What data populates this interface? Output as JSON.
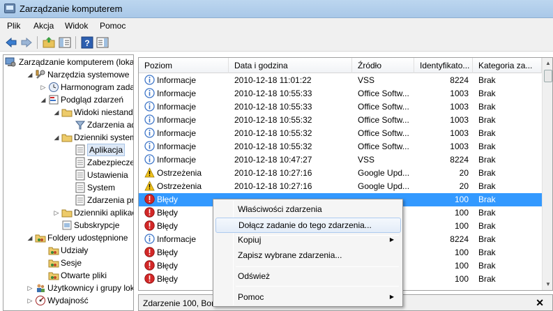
{
  "window": {
    "title": "Zarządzanie komputerem"
  },
  "menu": [
    "Plik",
    "Akcja",
    "Widok",
    "Pomoc"
  ],
  "toolbar": {
    "icons": [
      "back-arrow-icon",
      "forward-arrow-icon",
      "up-folder-icon",
      "show-hide-tree-icon",
      "help-icon",
      "action-pane-icon"
    ]
  },
  "tree": [
    {
      "label": "Zarządzanie komputerem (loka",
      "icon": "computer-management-icon",
      "expander": ""
    },
    {
      "label": "Narzędzia systemowe",
      "icon": "tools-icon",
      "expander": "◢"
    },
    {
      "label": "Harmonogram zadań",
      "icon": "clock-icon",
      "expander": "▷"
    },
    {
      "label": "Podgląd zdarzeń",
      "icon": "event-viewer-icon",
      "expander": "◢"
    },
    {
      "label": "Widoki niestandardo",
      "icon": "folder-icon",
      "expander": "◢"
    },
    {
      "label": "Zdarzenia admir",
      "icon": "filter-icon",
      "expander": ""
    },
    {
      "label": "Dzienniki systemu W",
      "icon": "folder-icon",
      "expander": "◢"
    },
    {
      "label": "Aplikacja",
      "icon": "log-icon",
      "expander": "",
      "selected": true
    },
    {
      "label": "Zabezpieczenia",
      "icon": "log-icon",
      "expander": ""
    },
    {
      "label": "Ustawienia",
      "icon": "log-icon",
      "expander": ""
    },
    {
      "label": "System",
      "icon": "log-icon",
      "expander": ""
    },
    {
      "label": "Zdarzenia przesy",
      "icon": "log-icon",
      "expander": ""
    },
    {
      "label": "Dzienniki aplikacji i u",
      "icon": "folder-icon",
      "expander": "▷"
    },
    {
      "label": "Subskrypcje",
      "icon": "subscription-icon",
      "expander": ""
    },
    {
      "label": "Foldery udostępnione",
      "icon": "shared-folder-icon",
      "expander": "◢"
    },
    {
      "label": "Udziały",
      "icon": "shared-folder-icon",
      "expander": ""
    },
    {
      "label": "Sesje",
      "icon": "shared-folder-icon",
      "expander": ""
    },
    {
      "label": "Otwarte pliki",
      "icon": "shared-folder-icon",
      "expander": ""
    },
    {
      "label": "Użytkownicy i grupy lok",
      "icon": "users-icon",
      "expander": "▷"
    },
    {
      "label": "Wydajność",
      "icon": "performance-icon",
      "expander": "▷"
    }
  ],
  "events": {
    "columns": [
      "Poziom",
      "Data i godzina",
      "Źródło",
      "Identyfikato...",
      "Kategoria za..."
    ],
    "rows": [
      {
        "level": "Informacje",
        "type": "info",
        "datetime": "2010-12-18 11:01:22",
        "source": "VSS",
        "id": "8224",
        "category": "Brak"
      },
      {
        "level": "Informacje",
        "type": "info",
        "datetime": "2010-12-18 10:55:33",
        "source": "Office Softw...",
        "id": "1003",
        "category": "Brak"
      },
      {
        "level": "Informacje",
        "type": "info",
        "datetime": "2010-12-18 10:55:33",
        "source": "Office Softw...",
        "id": "1003",
        "category": "Brak"
      },
      {
        "level": "Informacje",
        "type": "info",
        "datetime": "2010-12-18 10:55:32",
        "source": "Office Softw...",
        "id": "1003",
        "category": "Brak"
      },
      {
        "level": "Informacje",
        "type": "info",
        "datetime": "2010-12-18 10:55:32",
        "source": "Office Softw...",
        "id": "1003",
        "category": "Brak"
      },
      {
        "level": "Informacje",
        "type": "info",
        "datetime": "2010-12-18 10:55:32",
        "source": "Office Softw...",
        "id": "1003",
        "category": "Brak"
      },
      {
        "level": "Informacje",
        "type": "info",
        "datetime": "2010-12-18 10:47:27",
        "source": "VSS",
        "id": "8224",
        "category": "Brak"
      },
      {
        "level": "Ostrzeżenia",
        "type": "warning",
        "datetime": "2010-12-18 10:27:16",
        "source": "Google Upd...",
        "id": "20",
        "category": "Brak"
      },
      {
        "level": "Ostrzeżenia",
        "type": "warning",
        "datetime": "2010-12-18 10:27:16",
        "source": "Google Upd...",
        "id": "20",
        "category": "Brak"
      },
      {
        "level": "Błędy",
        "type": "error",
        "datetime": "",
        "source": "",
        "id": "100",
        "category": "Brak",
        "selected": true
      },
      {
        "level": "Błędy",
        "type": "error",
        "datetime": "",
        "source": "",
        "id": "100",
        "category": "Brak"
      },
      {
        "level": "Błędy",
        "type": "error",
        "datetime": "",
        "source": "",
        "id": "100",
        "category": "Brak"
      },
      {
        "level": "Informacje",
        "type": "info",
        "datetime": "",
        "source": "",
        "id": "8224",
        "category": "Brak"
      },
      {
        "level": "Błędy",
        "type": "error",
        "datetime": "",
        "source": "",
        "id": "100",
        "category": "Brak"
      },
      {
        "level": "Błędy",
        "type": "error",
        "datetime": "",
        "source": "",
        "id": "100",
        "category": "Brak"
      },
      {
        "level": "Błędy",
        "type": "error",
        "datetime": "",
        "source": "",
        "id": "100",
        "category": "Brak"
      }
    ]
  },
  "detail": {
    "text": "Zdarzenie 100, Bon"
  },
  "context_menu": {
    "items": [
      {
        "label": "Właściwości zdarzenia",
        "submenu": false
      },
      {
        "label": "Dołącz zadanie do tego zdarzenia...",
        "submenu": false,
        "hover": true
      },
      {
        "label": "Kopiuj",
        "submenu": true
      },
      {
        "label": "Zapisz wybrane zdarzenia...",
        "submenu": false
      },
      {
        "label": "Odśwież",
        "submenu": false
      },
      {
        "label": "Pomoc",
        "submenu": true
      }
    ]
  },
  "colors": {
    "selection": "#3399ff",
    "titlebar": "#bcd6ef",
    "info": "#3c74c8",
    "warning": "#f2c31b",
    "error": "#d22727"
  }
}
